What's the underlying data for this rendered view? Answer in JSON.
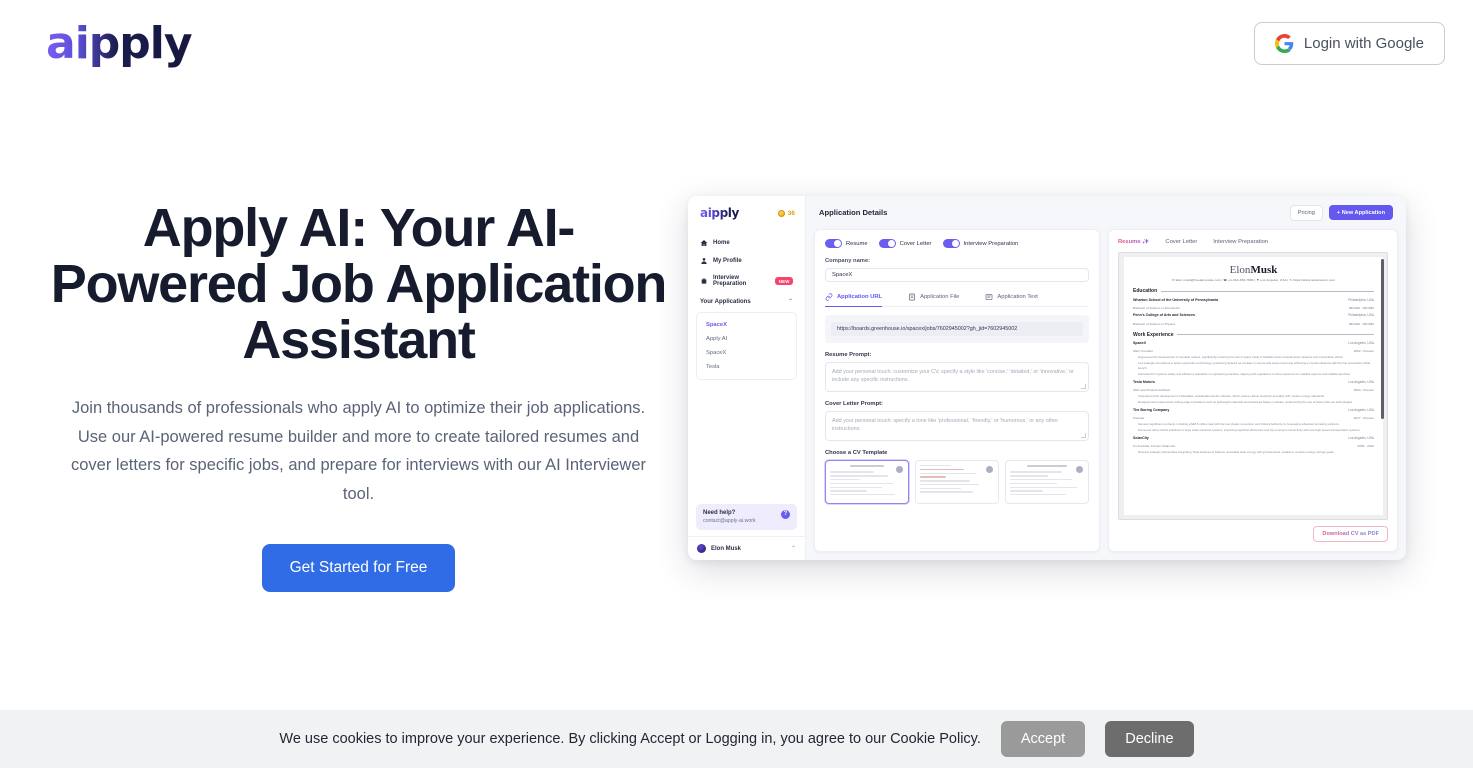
{
  "header": {
    "logo": "aipply",
    "login_label": "Login with Google",
    "google_icon": "google-g-icon"
  },
  "hero": {
    "title": "Apply AI: Your AI-Powered Job Application Assistant",
    "subtitle": "Join thousands of professionals who apply AI to optimize their job applications. Use our AI-powered resume builder and more to create tailored resumes and cover letters for specific jobs, and prepare for interviews with our AI Interviewer tool.",
    "cta_label": "Get Started for Free",
    "cta_color": "#2f6ce5"
  },
  "mockup": {
    "sidebar": {
      "logo": "aipply",
      "coins": "36",
      "nav": [
        {
          "label": "Home",
          "icon": "home-icon"
        },
        {
          "label": "My Profile",
          "icon": "user-icon"
        },
        {
          "label": "Interview Preparation",
          "icon": "briefcase-icon",
          "badge": "NEW"
        }
      ],
      "section_label": "Your Applications",
      "applications": [
        "SpaceX",
        "Apply AI",
        "SpaceX",
        "Tesla"
      ],
      "help": {
        "title": "Need help?",
        "email": "contact@apply-ai.work",
        "icon": "question-mark-icon"
      },
      "user": "Elon Musk"
    },
    "main": {
      "title": "Application Details",
      "pricing_label": "Pricing",
      "new_app_label": "+ New Application",
      "toggles": [
        {
          "label": "Resume",
          "on": true
        },
        {
          "label": "Cover Letter",
          "on": true
        },
        {
          "label": "Interview Preparation",
          "on": true
        }
      ],
      "company_label": "Company name:",
      "company_value": "SpaceX",
      "source_tabs": [
        {
          "label": "Application URL",
          "icon": "link-icon",
          "active": true
        },
        {
          "label": "Application File",
          "icon": "file-icon",
          "active": false
        },
        {
          "label": "Application Text",
          "icon": "text-icon",
          "active": false
        }
      ],
      "url_value": "https://boards.greenhouse.io/spacex/jobs/7602945002?gh_jid=7602945002",
      "resume_prompt_label": "Resume Prompt:",
      "resume_prompt_placeholder": "Add your personal touch: customize your CV, specify a style like 'concise,' 'detailed,' or 'innovative,' or include any specific instructions.",
      "cover_prompt_label": "Cover Letter Prompt:",
      "cover_prompt_placeholder": "Add your personal touch: specify a tone like 'professional,' 'friendly,' or 'humorous,' or any other instructions.",
      "template_label": "Choose a CV Template"
    },
    "preview": {
      "tabs": [
        {
          "label": "Resume ✨",
          "active": true
        },
        {
          "label": "Cover Letter",
          "active": false
        },
        {
          "label": "Interview Preparation",
          "active": false
        }
      ],
      "download_label": "Download CV as PDF",
      "resume": {
        "first_name": "Elon",
        "last_name": "Musk",
        "contact": "✉ Elon.musk@freelancetute.com  |  ☎ +1-310-456-7890  |  ⚑ Los Angeles, USA  |  ✎ https://www.teslamotors.com",
        "education_heading": "Education",
        "education": [
          {
            "org": "Wharton School of the University of Pennsylvania",
            "sub": "Bachelor of Science in Economics",
            "loc": "Philadelphia, USA",
            "dates": "08/1992 - 05/1995"
          },
          {
            "org": "Penn's College of Arts and Sciences",
            "sub": "Bachelor of Science in Physics",
            "loc": "Philadelphia, USA",
            "dates": "08/1992 - 05/1995"
          }
        ],
        "work_heading": "Work Experience",
        "work": [
          {
            "org": "SpaceX",
            "sub": "CEO, Founder",
            "loc": "Los Angeles, USA",
            "dates": "2002 - Present",
            "bullets": [
              "Engineered the development of reusable rockets, significantly reducing the cost of space travel to facilitate future interplanetary missions and colonization efforts.",
              "Led strategic innovations in space exploration technology, positioning SpaceX as a leader in commercial space travel and achieving a crucial milestone with the first successful orbital launch.",
              "Advocated for rigorous safety and efficiency standards in engineering practices, aligning with regulations to drive expansion for satellite systems and reliable launches."
            ]
          },
          {
            "org": "Tesla Motors",
            "sub": "CEO and Product Architect",
            "loc": "Los Angeles, USA",
            "dates": "2004 - Present",
            "bullets": [
              "Championed the development of affordable, sustainable electric vehicles, which reduce carbon footprints and align with modern energy standards.",
              "Designed and implemented cutting-edge innovations such as lightweight materials and advanced battery modules, underscoring the use of state-of-the-art technologies."
            ]
          },
          {
            "org": "The Boring Company",
            "sub": "Founder",
            "loc": "Los Angeles, USA",
            "dates": "2017 - Present",
            "bullets": [
              "Secured significant contracts, including a $48.6 million deal with the Las Vegas Convention and Visitors Authority, by leveraging advanced tunneling solutions.",
              "Pioneered urban transit initiatives to large scale electrical systems, improving logistical efficiencies and city-to-airport connectivity with new high-speed transportation systems."
            ]
          },
          {
            "org": "SolarCity",
            "sub": "Co-Founder, Former Chairman",
            "loc": "Los Angeles, USA",
            "dates": "2006 - 2016",
            "bullets": [
              "Directed strategic partnerships integrating Tesla batteries to balance renewable solar energy with grid demands, parallel to complex energy storage goals."
            ]
          }
        ]
      }
    }
  },
  "cookie": {
    "text": "We use cookies to improve your experience. By clicking Accept or Logging in, you agree to our Cookie Policy.",
    "accept_label": "Accept",
    "decline_label": "Decline"
  }
}
